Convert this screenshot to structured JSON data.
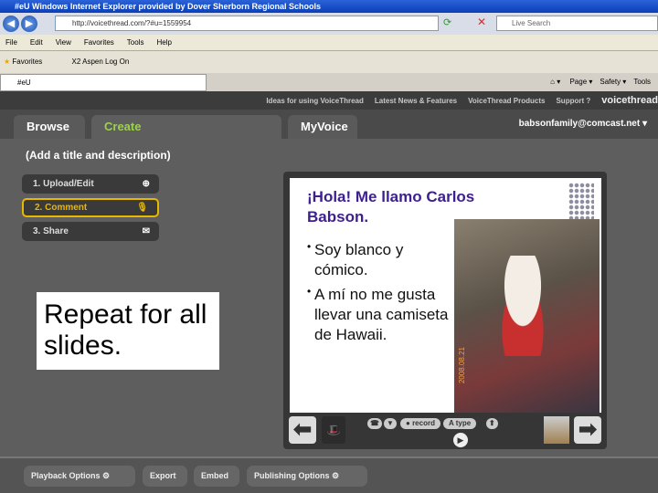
{
  "browser": {
    "title": "#eU   Windows Internet Explorer provided by Dover Sherborn Regional Schools",
    "url": "http://voicethread.com/?#u=1559954",
    "search_placeholder": "Live Search",
    "menu": [
      "File",
      "Edit",
      "View",
      "Favorites",
      "Tools",
      "Help"
    ],
    "favorites_label": "Favorites",
    "favorite_link": "X2 Aspen Log On",
    "tab_title": "#eU",
    "commands": [
      "Page ▾",
      "Safety ▾",
      "Tools"
    ]
  },
  "vt_nav": {
    "links": [
      "Ideas for using VoiceThread",
      "Latest News & Features",
      "VoiceThread Products",
      "Support ?"
    ],
    "logo": "voicethread"
  },
  "tabs": [
    "Browse",
    "Create",
    "MyVoice"
  ],
  "user": "babsonfamily@comcast.net ▾",
  "add_title": "(Add a title and description)",
  "steps": [
    "1. Upload/Edit",
    "2. Comment",
    "3. Share"
  ],
  "overlay_text": "Repeat for all slides.",
  "slide": {
    "title": "¡Hola!  Me llamo Carlos Babson.",
    "bullets": [
      "Soy blanco y cómico.",
      "A mí no me gusta llevar una camiseta de Hawaii."
    ],
    "photo_date": "2008.08.21"
  },
  "controls": {
    "record": "record",
    "type": "type"
  },
  "bottom": [
    "Playback Options",
    "Export",
    "Embed",
    "Publishing Options"
  ]
}
